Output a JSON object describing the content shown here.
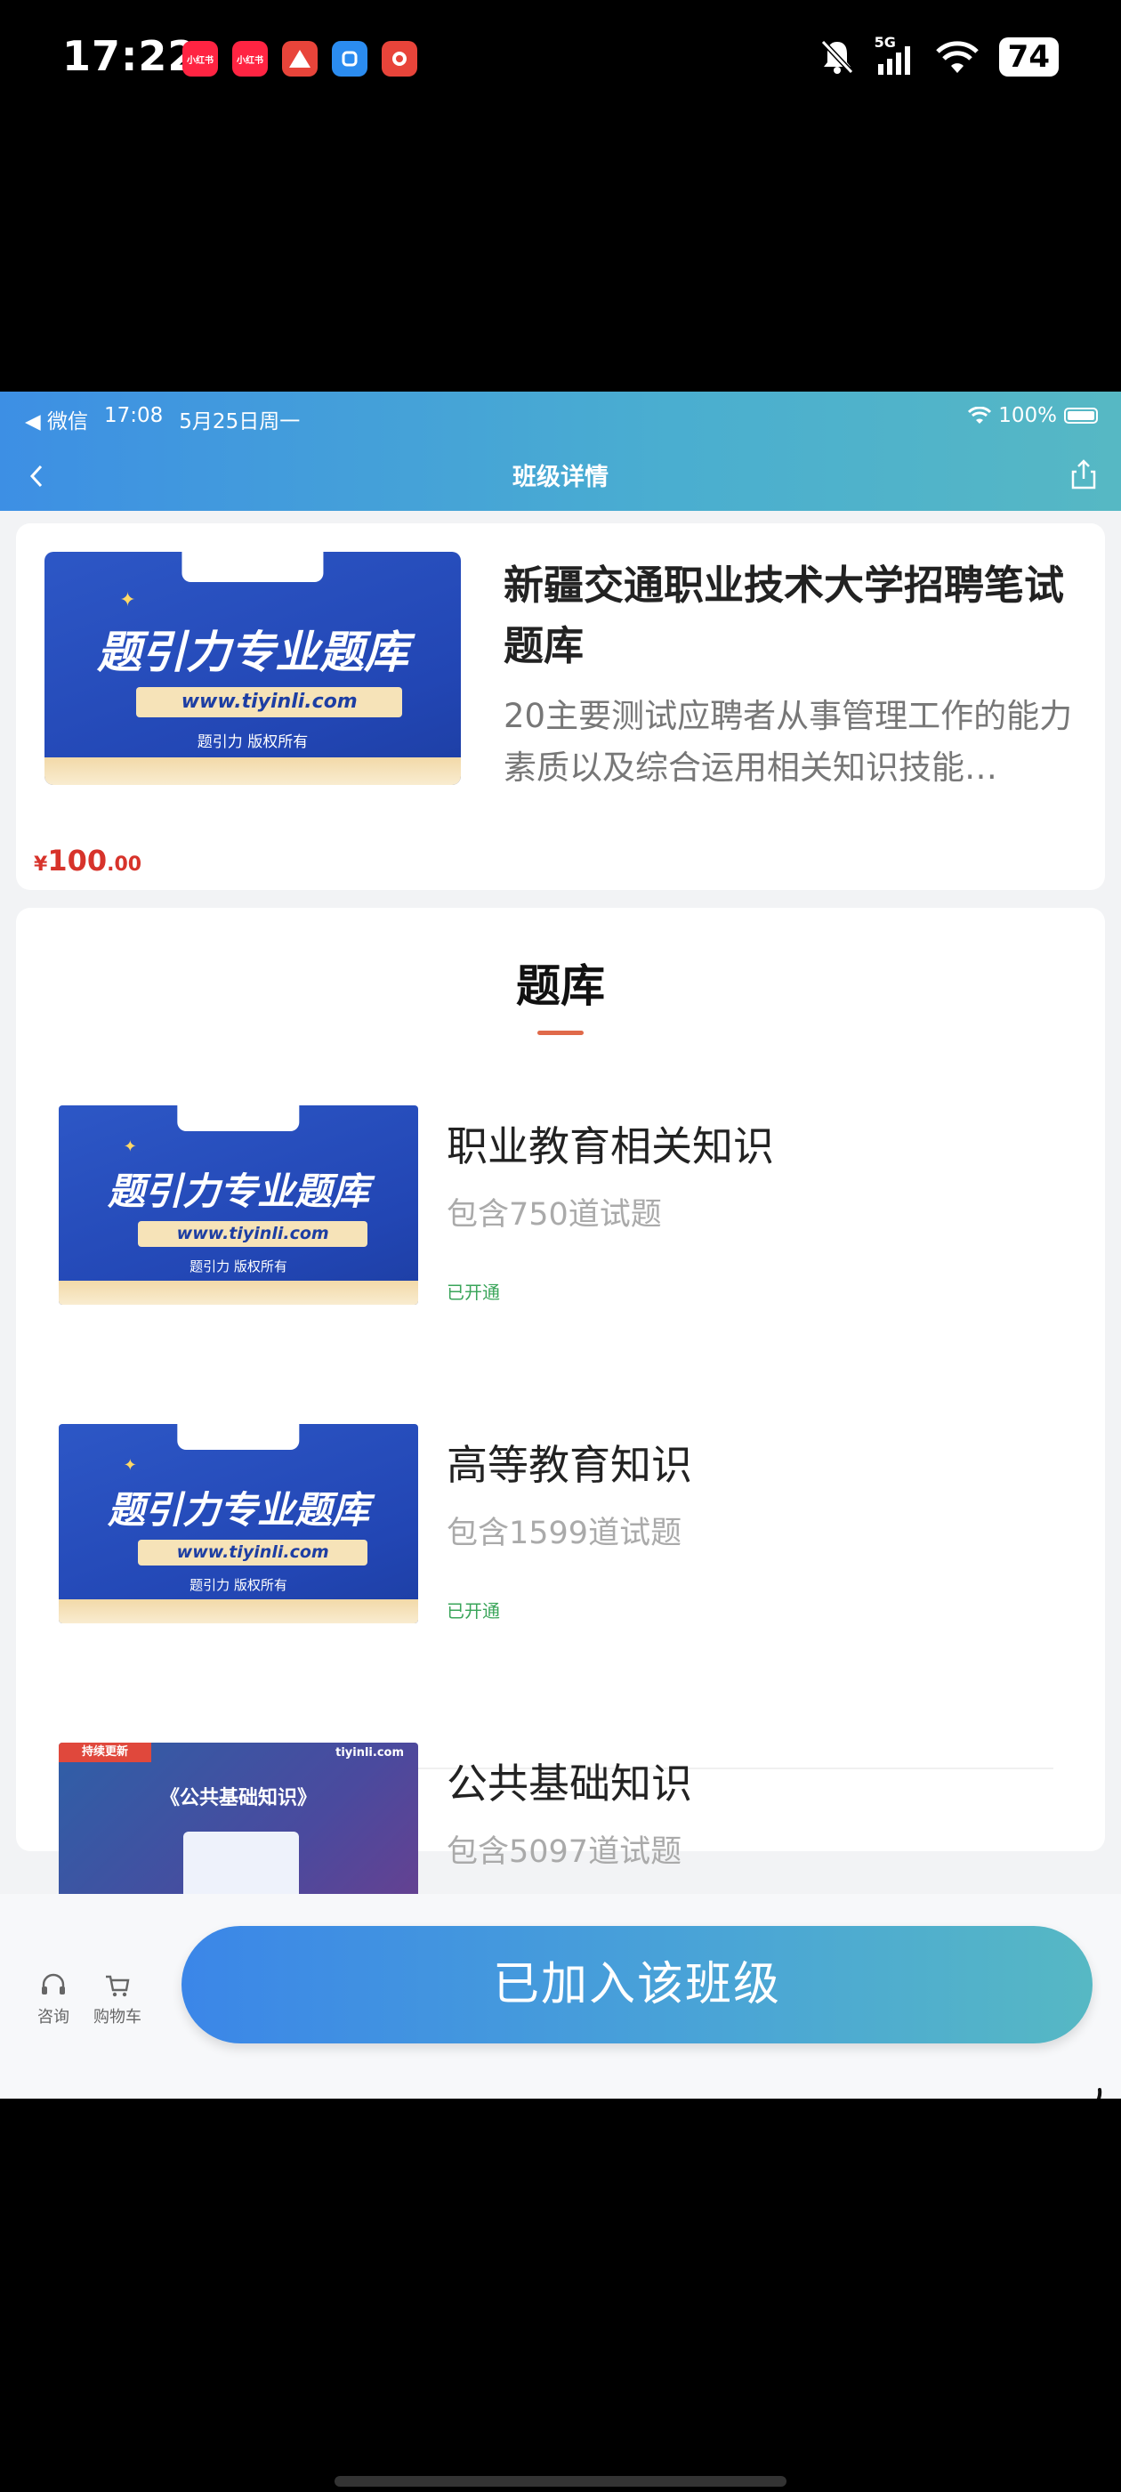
{
  "phone_status": {
    "time": "17:22",
    "network": "5G",
    "battery": "74",
    "app_icons": [
      {
        "name": "xiaohongshu-icon",
        "label": "小红书",
        "color": "#ff2442"
      },
      {
        "name": "xiaohongshu-icon-2",
        "label": "小红书",
        "color": "#ff2442"
      },
      {
        "name": "app-triangle-icon",
        "label": "",
        "color": "#e8443a"
      },
      {
        "name": "app-blue-icon",
        "label": "",
        "color": "#2b8cf0"
      },
      {
        "name": "app-flower-icon",
        "label": "",
        "color": "#e8443a"
      }
    ]
  },
  "ios_status": {
    "back_app": "◀ 微信",
    "time": "17:08",
    "date": "5月25日周一",
    "battery": "100%"
  },
  "nav": {
    "title": "班级详情"
  },
  "banner": {
    "title": "题引力专业题库",
    "url": "www.tiyinli.com",
    "rights": "题引力 版权所有",
    "tab": "题引力"
  },
  "course": {
    "title": "新疆交通职业技术大学招聘笔试题库",
    "description": "20主要测试应聘者从事管理工作的能力素质以及综合运用相关知识技能…",
    "price_symbol": "¥",
    "price_int": "100",
    "price_dec": ".00"
  },
  "section": {
    "title": "题库"
  },
  "items": [
    {
      "name": "职业教育相关知识",
      "count": "包含750道试题",
      "status": "已开通"
    },
    {
      "name": "高等教育知识",
      "count": "包含1599道试题",
      "status": "已开通"
    },
    {
      "name": "公共基础知识",
      "count": "包含5097道试题",
      "status": ""
    }
  ],
  "alt_banner": {
    "ribbon": "持续更新",
    "logo": "tiyinli.com",
    "title": "《公共基础知识》"
  },
  "bottom": {
    "consult": "咨询",
    "cart": "购物车",
    "join": "已加入该班级"
  },
  "colors": {
    "accent_gradient_start": "#3b86e8",
    "accent_gradient_end": "#56b8c4",
    "price": "#d7332b",
    "status_open": "#3aa55a"
  }
}
